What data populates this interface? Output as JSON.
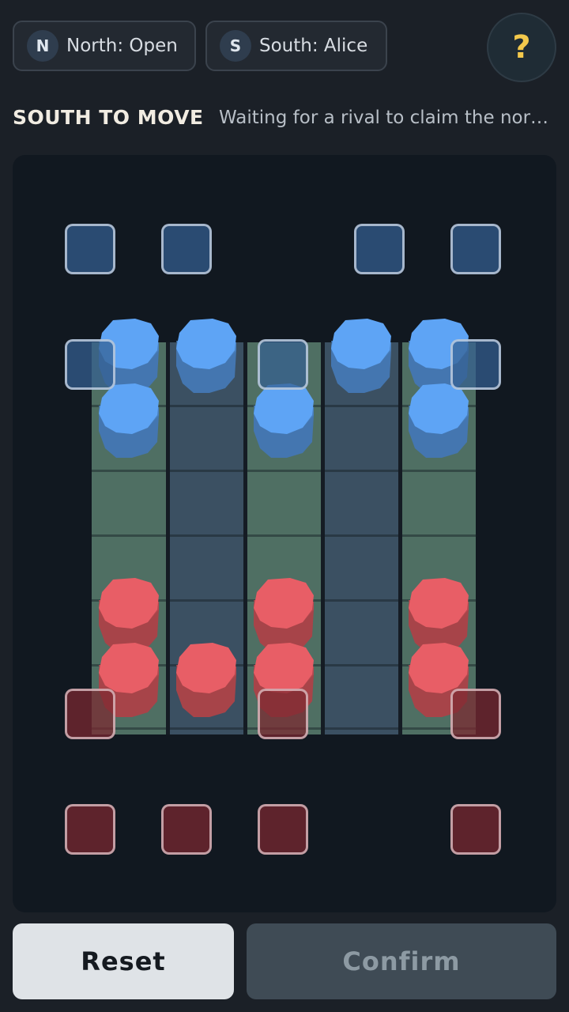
{
  "players": {
    "north": {
      "badge": "N",
      "label": "North: Open"
    },
    "south": {
      "badge": "S",
      "label": "South: Alice"
    }
  },
  "help_label": "?",
  "status": {
    "title": "SOUTH TO MOVE",
    "message": "Waiting for a rival to claim the north seat..."
  },
  "board": {
    "columns": 5,
    "rows": 6,
    "column_colors": [
      "green",
      "blue",
      "green",
      "blue",
      "green"
    ],
    "north_pieces": [
      [
        0,
        0
      ],
      [
        1,
        0
      ],
      [
        2,
        1
      ],
      [
        3,
        0
      ],
      [
        4,
        0
      ],
      [
        0,
        1
      ],
      [
        4,
        1
      ]
    ],
    "south_pieces": [
      [
        0,
        4
      ],
      [
        0,
        5
      ],
      [
        1,
        5
      ],
      [
        2,
        4
      ],
      [
        2,
        5
      ],
      [
        4,
        4
      ],
      [
        4,
        5
      ]
    ],
    "north_color": "#5ea4f5",
    "south_color": "#e85e66"
  },
  "actions": {
    "reset": "Reset",
    "confirm": "Confirm"
  }
}
